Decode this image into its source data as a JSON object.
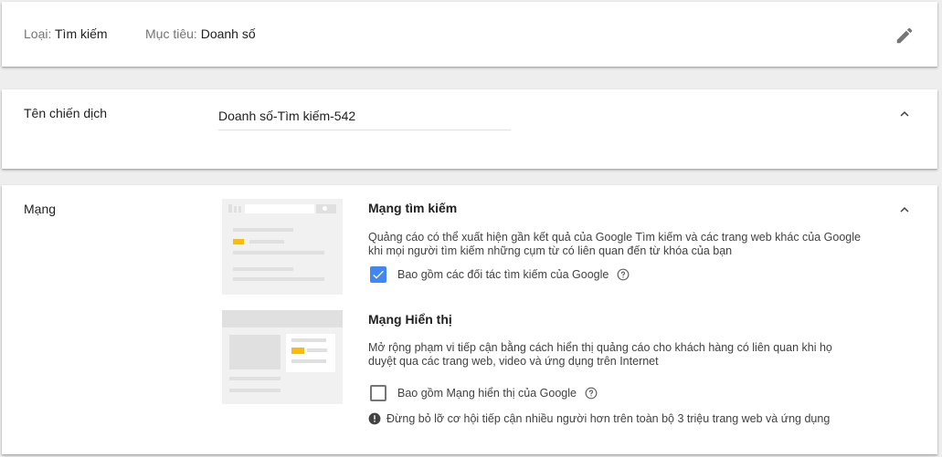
{
  "summary": {
    "type_label": "Loại:",
    "type_value": "Tìm kiếm",
    "goal_label": "Mục tiêu:",
    "goal_value": "Doanh số",
    "edit_icon": "pencil-icon"
  },
  "campaign_name": {
    "label": "Tên chiến dịch",
    "value": "Doanh số-Tìm kiếm-542",
    "collapse_icon": "chevron-up-icon"
  },
  "network": {
    "label": "Mạng",
    "collapse_icon": "chevron-up-icon",
    "search": {
      "title": "Mạng tìm kiếm",
      "description": "Quảng cáo có thể xuất hiện gần kết quả của Google Tìm kiếm và các trang web khác của Google khi mọi người tìm kiếm những cụm từ có liên quan đến từ khóa của bạn",
      "checkbox_label": "Bao gồm các đối tác tìm kiếm của Google",
      "checked": true
    },
    "display": {
      "title": "Mạng Hiển thị",
      "description": "Mở rộng phạm vi tiếp cận bằng cách hiển thị quảng cáo cho khách hàng có liên quan khi họ duyệt qua các trang web, video và ứng dụng trên Internet",
      "checkbox_label": "Bao gồm Mạng hiển thị của Google",
      "checked": false,
      "warning": "Đừng bỏ lỡ cơ hội tiếp cận nhiều người hơn trên toàn bộ 3 triệu trang web và ứng dụng"
    }
  },
  "colors": {
    "accent": "#4285f4",
    "highlight": "#fbbc04",
    "icon_gray": "#757575"
  }
}
